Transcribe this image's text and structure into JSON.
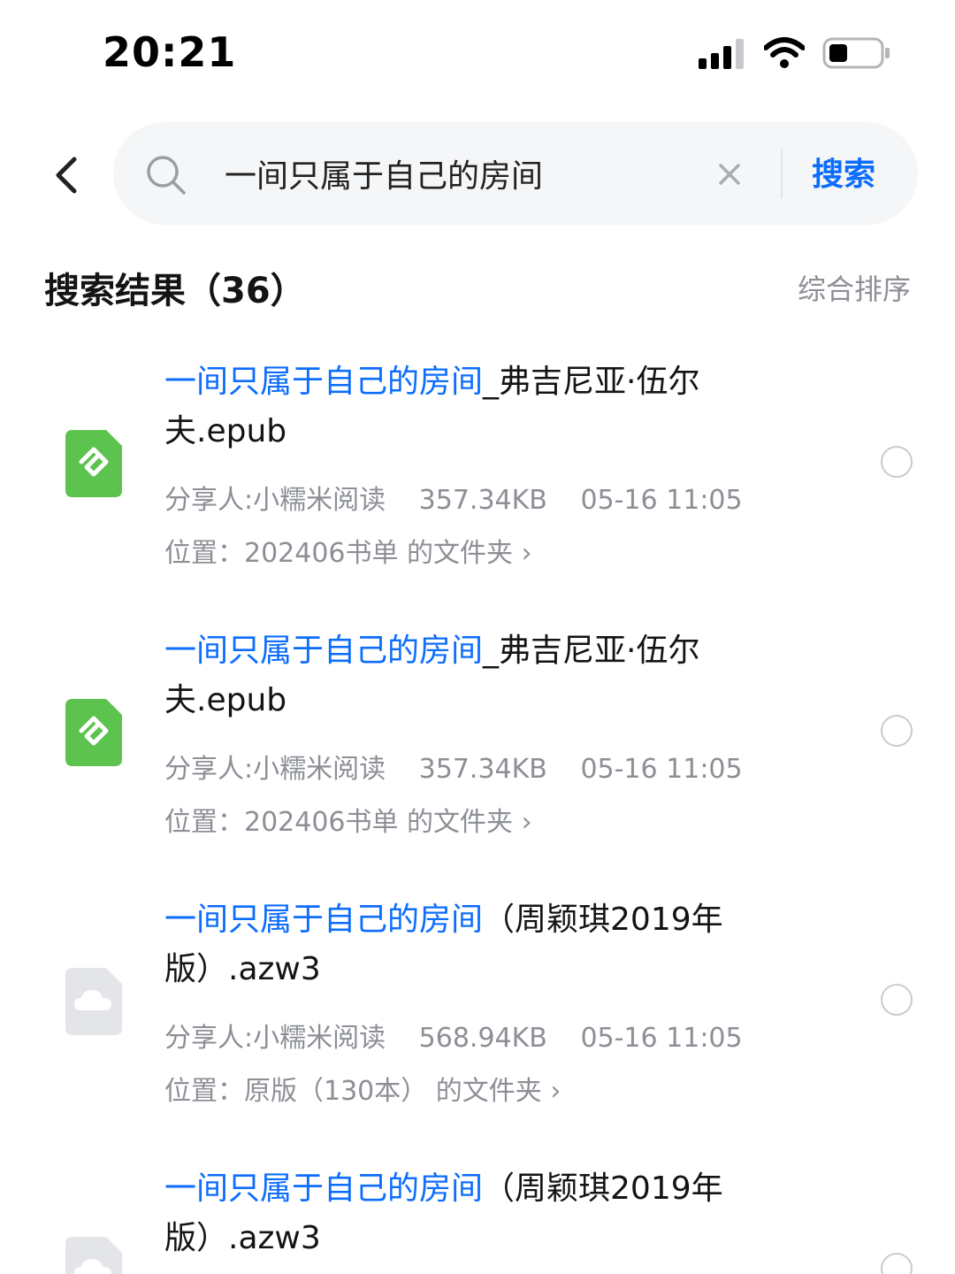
{
  "status": {
    "time": "20:21"
  },
  "search": {
    "query": "一间只属于自己的房间",
    "button_label": "搜索"
  },
  "results": {
    "heading": "搜索结果（36）",
    "sort_label": "综合排序",
    "items": [
      {
        "title_highlight": "一间只属于自己的房间",
        "title_rest": "_弗吉尼亚·伍尔夫.epub",
        "file_type": "epub",
        "sharer": "分享人:小糯米阅读",
        "size": "357.34KB",
        "date": "05-16 11:05",
        "location": "位置：202406书单 的文件夹 ›"
      },
      {
        "title_highlight": "一间只属于自己的房间",
        "title_rest": "_弗吉尼亚·伍尔夫.epub",
        "file_type": "epub",
        "sharer": "分享人:小糯米阅读",
        "size": "357.34KB",
        "date": "05-16 11:05",
        "location": "位置：202406书单 的文件夹 ›"
      },
      {
        "title_highlight": "一间只属于自己的房间",
        "title_rest": "（周颖琪2019年版）.azw3",
        "file_type": "cloud-file",
        "sharer": "分享人:小糯米阅读",
        "size": "568.94KB",
        "date": "05-16 11:05",
        "location": "位置：原版（130本） 的文件夹 ›"
      },
      {
        "title_highlight": "一间只属于自己的房间",
        "title_rest": "（周颖琪2019年版）.azw3",
        "file_type": "cloud-file"
      }
    ]
  },
  "colors": {
    "accent": "#0d6dfd",
    "epub_green": "#5cc34f",
    "muted_text": "#8c8f96"
  }
}
